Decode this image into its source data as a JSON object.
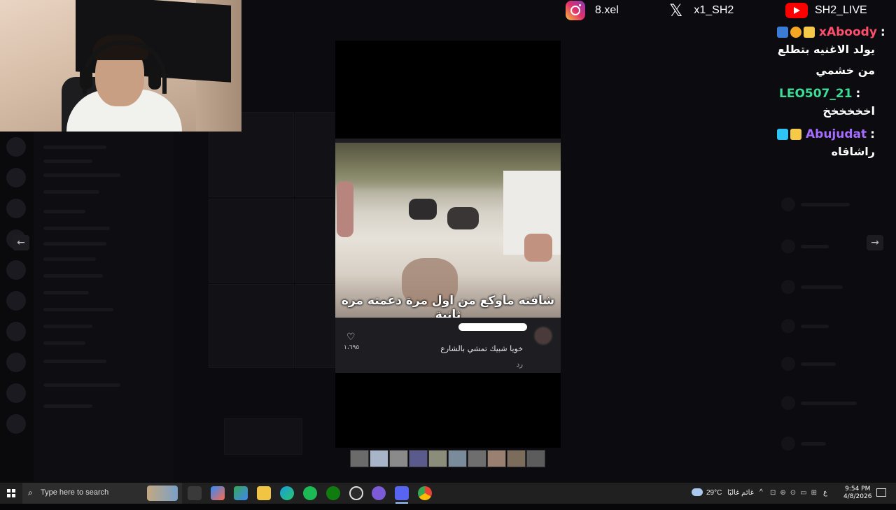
{
  "social": {
    "instagram_handle": "8.xel",
    "x_handle": "x1_SH2",
    "youtube_handle": "SH2_LIVE"
  },
  "chat": [
    {
      "username": "xAboody",
      "color": "#ff4d6d",
      "badges": [
        "prime",
        "sub-1",
        "crown"
      ],
      "message": "يولد الاغنيه بتطلع من خشمي"
    },
    {
      "username": "LEO507_21",
      "color": "#3ddc97",
      "badges": [],
      "message": "اخخخخخخ"
    },
    {
      "username": "Abujudat",
      "color": "#a66cff",
      "badges": [
        "cube",
        "crown"
      ],
      "message": "راشاقاه"
    }
  ],
  "post": {
    "caption": "شافته ماوكع من اول مرة دعمته مره ثانية",
    "comment": "خويا شبيك تمشي بالشارع",
    "reply_label": "رد",
    "like_count": "١،٦٩٥"
  },
  "thumbnails": [
    "#6b6b6b",
    "#a8b4c8",
    "#8a8a8a",
    "#5a5a8c",
    "#8c8c7a",
    "#7a8c9c",
    "#6e6e6e",
    "#9a8070",
    "#7c6c5c",
    "#5c5c5c"
  ],
  "taskbar": {
    "search_placeholder": "Type here to search",
    "apps": [
      "task-view",
      "copilot",
      "play-store",
      "file-explorer",
      "edge",
      "spotify",
      "xbox",
      "obs",
      "discord-alt",
      "discord",
      "chrome"
    ],
    "weather_temp": "29°C",
    "weather_text": "غائم غالبًا",
    "lang": "ع",
    "time": "9:54 PM",
    "date": "4/8/2026"
  }
}
